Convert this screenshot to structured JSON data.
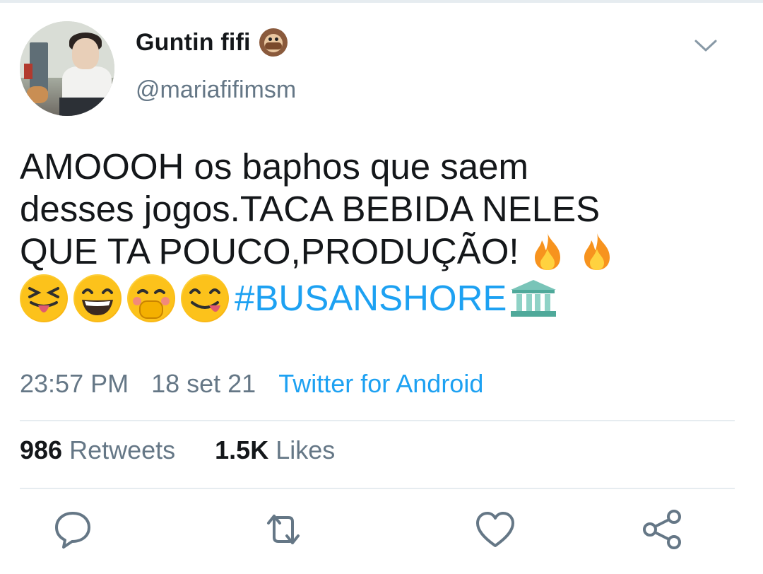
{
  "user": {
    "display_name": "Guntin fifi",
    "handle": "@mariafifimsm",
    "name_emoji": "see-no-evil-monkey-icon"
  },
  "tweet": {
    "line1": "AMOOOH os baphos que saem",
    "line2": "desses jogos.TACA BEBIDA NELES",
    "line3": "QUE TA POUCO,PRODUÇÃO!",
    "hashtag": "#BUSANSHORE",
    "emojis": [
      "fire-icon",
      "fire-icon",
      "squinting-tongue-face-icon",
      "grinning-squinting-face-icon",
      "face-with-hand-over-mouth-icon",
      "savoring-food-face-icon",
      "classical-building-icon"
    ]
  },
  "meta": {
    "time": "23:57 PM",
    "date": "18 set 21",
    "source": "Twitter for Android"
  },
  "stats": {
    "retweets_count": "986",
    "retweets_label": "Retweets",
    "likes_count": "1.5K",
    "likes_label": "Likes"
  },
  "actions": [
    "reply-icon",
    "retweet-icon",
    "like-icon",
    "share-icon"
  ],
  "colors": {
    "text": "#14171a",
    "secondary": "#657786",
    "link": "#1da1f2",
    "divider": "#e6ecf0"
  }
}
